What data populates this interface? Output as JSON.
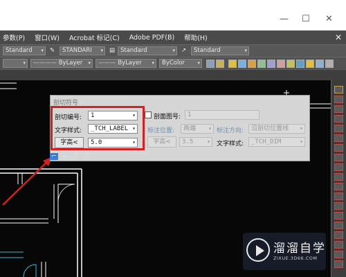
{
  "window": {
    "minimize": "—",
    "maximize": "☐",
    "close": "✕"
  },
  "menu": {
    "items": [
      "参数(P)",
      "窗口(W)",
      "Acrobat 标记(C)",
      "Adobe PDF(B)",
      "帮助(H)"
    ],
    "close": "✕"
  },
  "toolbar1": {
    "style_combo_1": "Standard",
    "style_combo_2": "STANDARI",
    "style_combo_3": "Standard",
    "style_combo_4": "Standard"
  },
  "toolbar2": {
    "linetype": "ByLayer",
    "lineweight": "ByLayer",
    "color": "ByColor"
  },
  "dialog": {
    "title": "剖切符号",
    "section_number_label": "剖切编号:",
    "section_number_value": "1",
    "text_style_label": "文字样式:",
    "text_style_value": "_TCH_LABEL",
    "text_height_button": "字高<",
    "text_height_value": "5.0",
    "section_drawing_label": "剖面图号:",
    "section_drawing_value": "1",
    "annotation_position_label": "标注位置:",
    "annotation_position_value": "两端",
    "annotation_direction_label": "标注方向:",
    "annotation_direction_value": "沿剖切位置线",
    "text_height2_button": "字高<",
    "text_height2_value": "3.5",
    "text_style2_label": "文字样式:",
    "text_style2_value": "_TCH_DIM"
  },
  "watermark": {
    "brand": "溜溜自学",
    "url": "ZIXUE.3D66.COM"
  },
  "colors": {
    "highlight": "#d42020",
    "arrow": "#d42020",
    "cad_lines": "#ffffff",
    "cyan_lines": "#3fb8d8"
  }
}
